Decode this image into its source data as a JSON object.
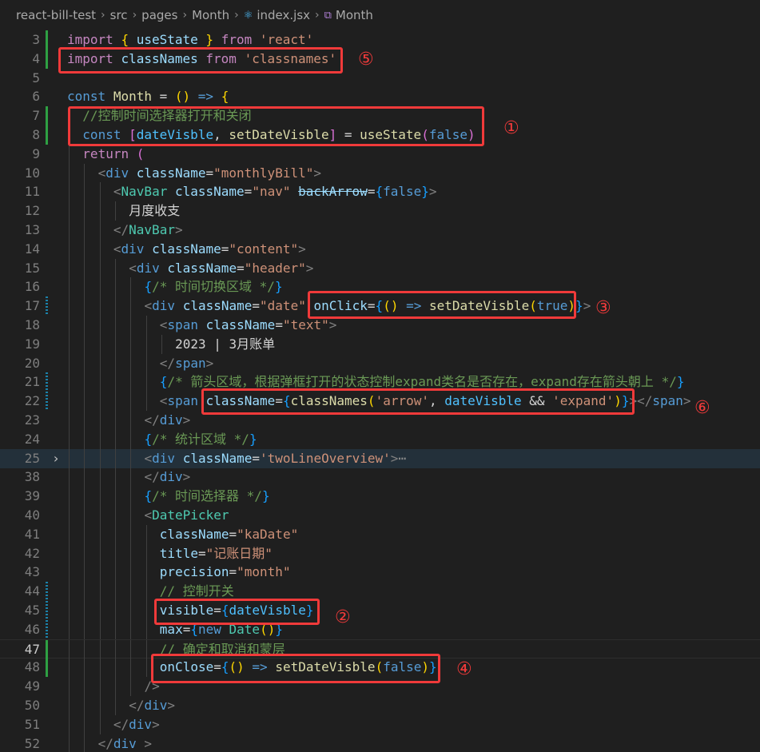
{
  "breadcrumb": {
    "items": [
      "react-bill-test",
      "src",
      "pages",
      "Month",
      "index.jsx",
      "Month"
    ],
    "separator": "›"
  },
  "markers": [
    "①",
    "②",
    "③",
    "④",
    "⑤",
    "⑥"
  ],
  "lines": [
    {
      "n": "3",
      "mark": "added",
      "indent": 0,
      "t": [
        [
          "ctl",
          "import"
        ],
        [
          "txt",
          " "
        ],
        [
          "br1",
          "{"
        ],
        [
          "txt",
          " "
        ],
        [
          "var",
          "useState"
        ],
        [
          "txt",
          " "
        ],
        [
          "br1",
          "}"
        ],
        [
          "txt",
          " "
        ],
        [
          "ctl",
          "from"
        ],
        [
          "txt",
          " "
        ],
        [
          "str",
          "'react'"
        ]
      ]
    },
    {
      "n": "4",
      "mark": "added",
      "indent": 0,
      "t": [
        [
          "ctl",
          "import"
        ],
        [
          "txt",
          " "
        ],
        [
          "var",
          "classNames"
        ],
        [
          "txt",
          " "
        ],
        [
          "ctl",
          "from"
        ],
        [
          "txt",
          " "
        ],
        [
          "str",
          "'classnames'"
        ]
      ]
    },
    {
      "n": "5",
      "indent": 0,
      "t": []
    },
    {
      "n": "6",
      "indent": 0,
      "t": [
        [
          "kw",
          "const"
        ],
        [
          "txt",
          " "
        ],
        [
          "fn",
          "Month"
        ],
        [
          "txt",
          " = "
        ],
        [
          "br1",
          "()"
        ],
        [
          "txt",
          " "
        ],
        [
          "kw",
          "=>"
        ],
        [
          "txt",
          " "
        ],
        [
          "br1",
          "{"
        ]
      ]
    },
    {
      "n": "7",
      "mark": "added",
      "indent": 1,
      "t": [
        [
          "cmt",
          "//控制时间选择器打开和关闭"
        ]
      ]
    },
    {
      "n": "8",
      "mark": "added",
      "indent": 1,
      "t": [
        [
          "kw",
          "const"
        ],
        [
          "txt",
          " "
        ],
        [
          "br2",
          "["
        ],
        [
          "cst",
          "dateVisble"
        ],
        [
          "txt",
          ", "
        ],
        [
          "fn",
          "setDateVisble"
        ],
        [
          "br2",
          "]"
        ],
        [
          "txt",
          " = "
        ],
        [
          "fn",
          "useState"
        ],
        [
          "br2",
          "("
        ],
        [
          "kw",
          "false"
        ],
        [
          "br2",
          ")"
        ]
      ]
    },
    {
      "n": "9",
      "indent": 1,
      "t": [
        [
          "ctl",
          "return"
        ],
        [
          "txt",
          " "
        ],
        [
          "br2",
          "("
        ]
      ]
    },
    {
      "n": "10",
      "indent": 2,
      "t": [
        [
          "tagp",
          "<"
        ],
        [
          "tag",
          "div"
        ],
        [
          "txt",
          " "
        ],
        [
          "attr",
          "className"
        ],
        [
          "txt",
          "="
        ],
        [
          "str",
          "\"monthlyBill\""
        ],
        [
          "tagp",
          ">"
        ]
      ]
    },
    {
      "n": "11",
      "indent": 3,
      "t": [
        [
          "tagp",
          "<"
        ],
        [
          "comp",
          "NavBar"
        ],
        [
          "txt",
          " "
        ],
        [
          "attr",
          "className"
        ],
        [
          "txt",
          "="
        ],
        [
          "str",
          "\"nav\""
        ],
        [
          "txt",
          " "
        ],
        [
          "attr strike",
          "backArrow"
        ],
        [
          "txt",
          "="
        ],
        [
          "br3",
          "{"
        ],
        [
          "kw",
          "false"
        ],
        [
          "br3",
          "}"
        ],
        [
          "tagp",
          ">"
        ]
      ]
    },
    {
      "n": "12",
      "indent": 4,
      "t": [
        [
          "txt",
          "月度收支"
        ]
      ]
    },
    {
      "n": "13",
      "indent": 3,
      "t": [
        [
          "tagp",
          "</"
        ],
        [
          "comp",
          "NavBar"
        ],
        [
          "tagp",
          ">"
        ]
      ]
    },
    {
      "n": "14",
      "indent": 3,
      "t": [
        [
          "tagp",
          "<"
        ],
        [
          "tag",
          "div"
        ],
        [
          "txt",
          " "
        ],
        [
          "attr",
          "className"
        ],
        [
          "txt",
          "="
        ],
        [
          "str",
          "\"content\""
        ],
        [
          "tagp",
          ">"
        ]
      ]
    },
    {
      "n": "15",
      "indent": 4,
      "t": [
        [
          "tagp",
          "<"
        ],
        [
          "tag",
          "div"
        ],
        [
          "txt",
          " "
        ],
        [
          "attr",
          "className"
        ],
        [
          "txt",
          "="
        ],
        [
          "str",
          "\"header\""
        ],
        [
          "tagp",
          ">"
        ]
      ]
    },
    {
      "n": "16",
      "indent": 5,
      "t": [
        [
          "br3",
          "{"
        ],
        [
          "cmt",
          "/* 时间切换区域 */"
        ],
        [
          "br3",
          "}"
        ]
      ]
    },
    {
      "n": "17",
      "mark": "modified",
      "indent": 5,
      "t": [
        [
          "tagp",
          "<"
        ],
        [
          "tag",
          "div"
        ],
        [
          "txt",
          " "
        ],
        [
          "attr",
          "className"
        ],
        [
          "txt",
          "="
        ],
        [
          "str",
          "\"date\""
        ],
        [
          "txt",
          " "
        ],
        [
          "attr",
          "onClick"
        ],
        [
          "txt",
          "="
        ],
        [
          "br3",
          "{"
        ],
        [
          "br1",
          "()"
        ],
        [
          "txt",
          " "
        ],
        [
          "kw",
          "=>"
        ],
        [
          "txt",
          " "
        ],
        [
          "fn",
          "setDateVisble"
        ],
        [
          "br1",
          "("
        ],
        [
          "kw",
          "true"
        ],
        [
          "br1",
          ")"
        ],
        [
          "br3",
          "}"
        ],
        [
          "tagp",
          ">"
        ]
      ]
    },
    {
      "n": "18",
      "indent": 6,
      "t": [
        [
          "tagp",
          "<"
        ],
        [
          "tag",
          "span"
        ],
        [
          "txt",
          " "
        ],
        [
          "attr",
          "className"
        ],
        [
          "txt",
          "="
        ],
        [
          "str",
          "\"text\""
        ],
        [
          "tagp",
          ">"
        ]
      ]
    },
    {
      "n": "19",
      "indent": 7,
      "t": [
        [
          "txt",
          "2023 | 3月账单"
        ]
      ]
    },
    {
      "n": "20",
      "indent": 6,
      "t": [
        [
          "tagp",
          "</"
        ],
        [
          "tag",
          "span"
        ],
        [
          "tagp",
          ">"
        ]
      ]
    },
    {
      "n": "21",
      "mark": "modified",
      "indent": 6,
      "t": [
        [
          "br3",
          "{"
        ],
        [
          "cmt",
          "/* 箭头区域，根据弹框打开的状态控制expand类名是否存在，expand存在箭头朝上 */"
        ],
        [
          "br3",
          "}"
        ]
      ]
    },
    {
      "n": "22",
      "mark": "modified",
      "indent": 6,
      "t": [
        [
          "tagp",
          "<"
        ],
        [
          "tag",
          "span"
        ],
        [
          "txt",
          " "
        ],
        [
          "attr",
          "className"
        ],
        [
          "txt",
          "="
        ],
        [
          "br3",
          "{"
        ],
        [
          "fn",
          "classNames"
        ],
        [
          "br1",
          "("
        ],
        [
          "str",
          "'arrow'"
        ],
        [
          "txt",
          ", "
        ],
        [
          "cst",
          "dateVisble"
        ],
        [
          "txt",
          " && "
        ],
        [
          "str",
          "'expand'"
        ],
        [
          "br1",
          ")"
        ],
        [
          "br3",
          "}"
        ],
        [
          "tagp",
          "></"
        ],
        [
          "tag",
          "span"
        ],
        [
          "tagp",
          ">"
        ]
      ]
    },
    {
      "n": "23",
      "indent": 5,
      "t": [
        [
          "tagp",
          "</"
        ],
        [
          "tag",
          "div"
        ],
        [
          "tagp",
          ">"
        ]
      ]
    },
    {
      "n": "24",
      "indent": 5,
      "t": [
        [
          "br3",
          "{"
        ],
        [
          "cmt",
          "/* 统计区域 */"
        ],
        [
          "br3",
          "}"
        ]
      ]
    },
    {
      "n": "25",
      "fold": "›",
      "folded": true,
      "indent": 5,
      "t": [
        [
          "tagp",
          "<"
        ],
        [
          "tag",
          "div"
        ],
        [
          "txt",
          " "
        ],
        [
          "attr",
          "className"
        ],
        [
          "txt",
          "="
        ],
        [
          "str",
          "'twoLineOverview'"
        ],
        [
          "tagp",
          ">"
        ],
        [
          "ellipsis",
          "⋯"
        ]
      ]
    },
    {
      "n": "38",
      "indent": 5,
      "t": [
        [
          "tagp",
          "</"
        ],
        [
          "tag",
          "div"
        ],
        [
          "tagp",
          ">"
        ]
      ]
    },
    {
      "n": "39",
      "indent": 5,
      "t": [
        [
          "br3",
          "{"
        ],
        [
          "cmt",
          "/* 时间选择器 */"
        ],
        [
          "br3",
          "}"
        ]
      ]
    },
    {
      "n": "40",
      "indent": 5,
      "t": [
        [
          "tagp",
          "<"
        ],
        [
          "comp",
          "DatePicker"
        ]
      ]
    },
    {
      "n": "41",
      "indent": 6,
      "t": [
        [
          "attr",
          "className"
        ],
        [
          "txt",
          "="
        ],
        [
          "str",
          "\"kaDate\""
        ]
      ]
    },
    {
      "n": "42",
      "indent": 6,
      "t": [
        [
          "attr",
          "title"
        ],
        [
          "txt",
          "="
        ],
        [
          "str",
          "\"记账日期\""
        ]
      ]
    },
    {
      "n": "43",
      "indent": 6,
      "t": [
        [
          "attr",
          "precision"
        ],
        [
          "txt",
          "="
        ],
        [
          "str",
          "\"month\""
        ]
      ]
    },
    {
      "n": "44",
      "mark": "modified",
      "indent": 6,
      "t": [
        [
          "cmt",
          "// 控制开关"
        ]
      ]
    },
    {
      "n": "45",
      "mark": "modified",
      "indent": 6,
      "t": [
        [
          "attr",
          "visible"
        ],
        [
          "txt",
          "="
        ],
        [
          "br3",
          "{"
        ],
        [
          "cst",
          "dateVisble"
        ],
        [
          "br3",
          "}"
        ]
      ]
    },
    {
      "n": "46",
      "mark": "modified",
      "indent": 6,
      "t": [
        [
          "attr",
          "max"
        ],
        [
          "txt",
          "="
        ],
        [
          "br3",
          "{"
        ],
        [
          "kw",
          "new"
        ],
        [
          "txt",
          " "
        ],
        [
          "comp",
          "Date"
        ],
        [
          "br1",
          "()"
        ],
        [
          "br3",
          "}"
        ]
      ]
    },
    {
      "n": "47",
      "mark": "added",
      "active": true,
      "indent": 6,
      "t": [
        [
          "cmt",
          "// 确定和取消和蒙层"
        ]
      ]
    },
    {
      "n": "48",
      "mark": "added",
      "indent": 6,
      "t": [
        [
          "attr",
          "onClose"
        ],
        [
          "txt",
          "="
        ],
        [
          "br3",
          "{"
        ],
        [
          "br1",
          "()"
        ],
        [
          "txt",
          " "
        ],
        [
          "kw",
          "=>"
        ],
        [
          "txt",
          " "
        ],
        [
          "fn",
          "setDateVisble"
        ],
        [
          "br1",
          "("
        ],
        [
          "kw",
          "false"
        ],
        [
          "br1",
          ")"
        ],
        [
          "br3",
          "}"
        ]
      ]
    },
    {
      "n": "49",
      "indent": 5,
      "t": [
        [
          "tagp",
          "/>"
        ]
      ]
    },
    {
      "n": "50",
      "indent": 4,
      "t": [
        [
          "tagp",
          "</"
        ],
        [
          "tag",
          "div"
        ],
        [
          "tagp",
          ">"
        ]
      ]
    },
    {
      "n": "51",
      "indent": 3,
      "t": [
        [
          "tagp",
          "</"
        ],
        [
          "tag",
          "div"
        ],
        [
          "tagp",
          ">"
        ]
      ]
    },
    {
      "n": "52",
      "indent": 2,
      "t": [
        [
          "tagp",
          "</"
        ],
        [
          "tag",
          "div"
        ],
        [
          "txt",
          " "
        ],
        [
          "tagp",
          ">"
        ]
      ]
    }
  ],
  "colors": {
    "highlight_box": "#f03a3a",
    "background": "#1f1f1f",
    "git_added": "#2ea043",
    "git_modified": "#1b81a8"
  }
}
